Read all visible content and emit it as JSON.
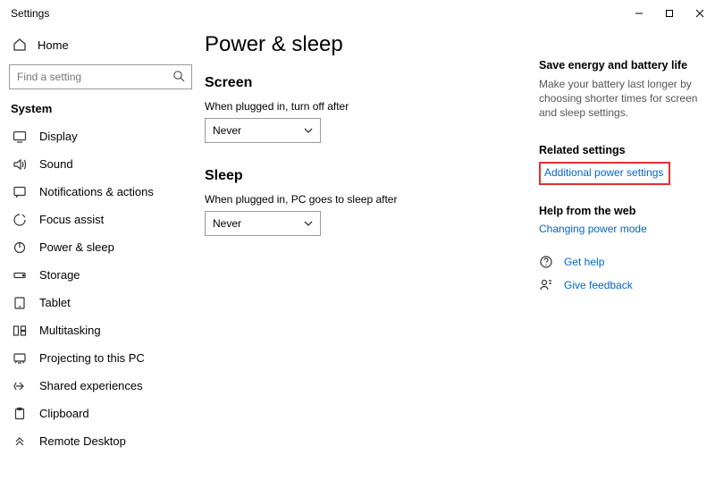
{
  "window": {
    "title": "Settings"
  },
  "sidebar": {
    "home": "Home",
    "searchPlaceholder": "Find a setting",
    "section": "System",
    "items": [
      {
        "label": "Display"
      },
      {
        "label": "Sound"
      },
      {
        "label": "Notifications & actions"
      },
      {
        "label": "Focus assist"
      },
      {
        "label": "Power & sleep"
      },
      {
        "label": "Storage"
      },
      {
        "label": "Tablet"
      },
      {
        "label": "Multitasking"
      },
      {
        "label": "Projecting to this PC"
      },
      {
        "label": "Shared experiences"
      },
      {
        "label": "Clipboard"
      },
      {
        "label": "Remote Desktop"
      }
    ]
  },
  "page": {
    "title": "Power & sleep",
    "screen": {
      "heading": "Screen",
      "label": "When plugged in, turn off after",
      "value": "Never"
    },
    "sleep": {
      "heading": "Sleep",
      "label": "When plugged in, PC goes to sleep after",
      "value": "Never"
    }
  },
  "aside": {
    "energyTitle": "Save energy and battery life",
    "energyBody": "Make your battery last longer by choosing shorter times for screen and sleep settings.",
    "relatedTitle": "Related settings",
    "relatedLink": "Additional power settings",
    "helpWebTitle": "Help from the web",
    "helpWebLink": "Changing power mode",
    "getHelp": "Get help",
    "feedback": "Give feedback"
  }
}
